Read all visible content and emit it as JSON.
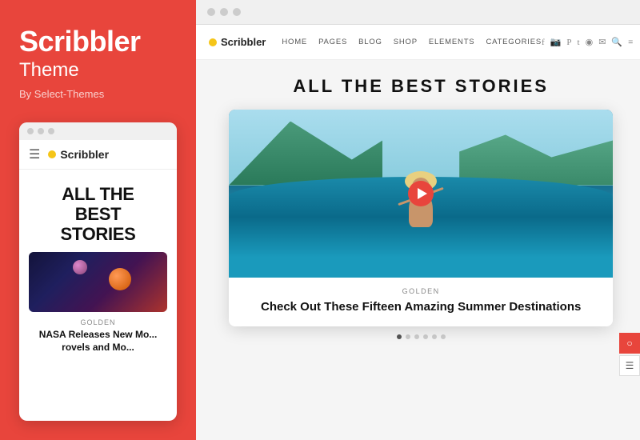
{
  "left": {
    "brand_name": "Scribbler",
    "brand_subtitle": "Theme",
    "brand_by": "By Select-Themes",
    "mobile_dots": [
      "dot1",
      "dot2",
      "dot3"
    ],
    "mobile_logo_text": "Scribbler",
    "mobile_headline_line1": "ALL THE",
    "mobile_headline_line2": "BEST",
    "mobile_headline_line3": "STORIES",
    "article_label": "GOLDEN",
    "article_title": "NASA Releases New Mo...",
    "article_title_line2": "rovels and Mo..."
  },
  "right": {
    "titlebar_dots": [
      "dot1",
      "dot2",
      "dot3"
    ],
    "nav": {
      "logo_text": "Scribbler",
      "links": [
        "HOME",
        "PAGES",
        "BLOG",
        "SHOP",
        "ELEMENTS",
        "CATEGORIES"
      ],
      "icons": [
        "facebook",
        "instagram",
        "pinterest",
        "tumblr",
        "rss",
        "mail",
        "search",
        "menu"
      ]
    },
    "headline": "ALL THE BEST STORIES",
    "hero": {
      "play_visible": true,
      "slide_tag": "GOLDEN",
      "slide_title": "Check Out These Fifteen Amazing Summer Destinations",
      "dots": [
        true,
        false,
        false,
        false,
        false,
        false
      ]
    }
  }
}
